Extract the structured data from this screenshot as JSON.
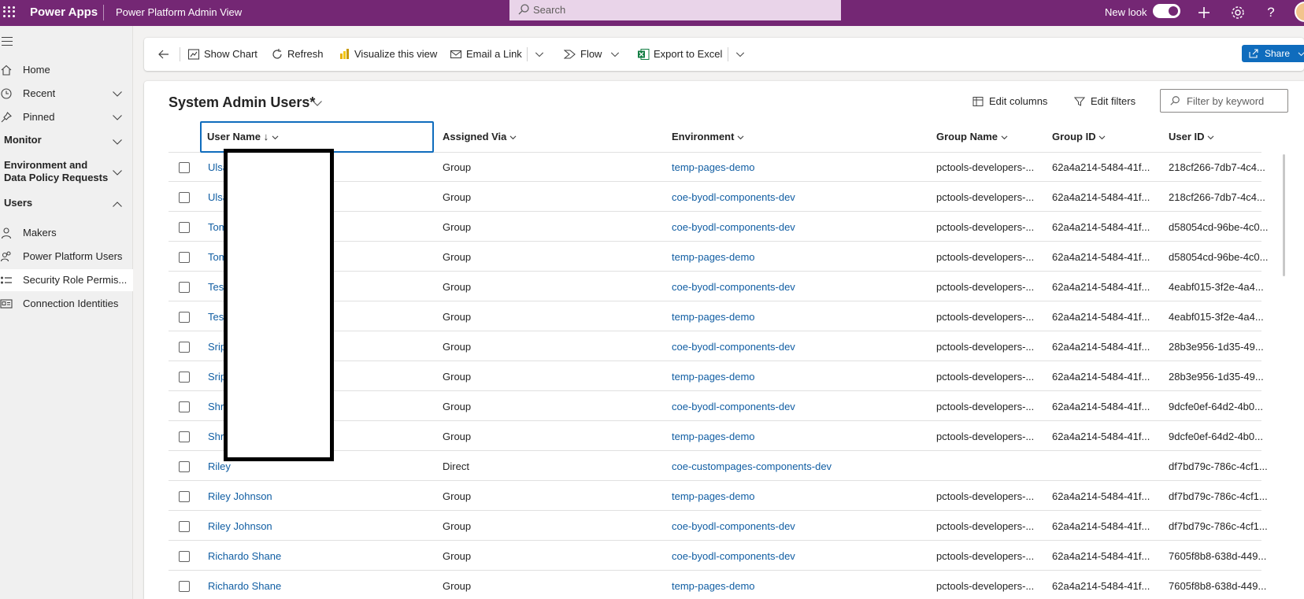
{
  "topbar": {
    "app_name": "Power Apps",
    "view_name": "Power Platform Admin View",
    "search_placeholder": "Search",
    "new_look_label": "New look",
    "new_look_on": true,
    "icons": [
      "waffle-icon",
      "search-icon",
      "plus-icon",
      "gear-icon",
      "help-icon",
      "avatar"
    ]
  },
  "nav": {
    "items": [
      {
        "label": "Home",
        "icon": "home-icon"
      },
      {
        "label": "Recent",
        "icon": "clock-icon",
        "expandable": true
      },
      {
        "label": "Pinned",
        "icon": "pin-icon",
        "expandable": true
      }
    ],
    "sections": [
      {
        "label": "Monitor"
      },
      {
        "label": "Environment and",
        "label2": "Data Policy Requests"
      },
      {
        "label": "Users"
      }
    ],
    "user_items": [
      {
        "label": "Makers",
        "icon": "person-icon"
      },
      {
        "label": "Power Platform Users",
        "icon": "people-icon"
      },
      {
        "label": "Security Role Permis...",
        "icon": "list-icon"
      },
      {
        "label": "Connection Identities",
        "icon": "id-card-icon"
      }
    ]
  },
  "commands": {
    "show_chart": "Show Chart",
    "refresh": "Refresh",
    "visualize": "Visualize this view",
    "email_link": "Email a Link",
    "flow": "Flow",
    "export_excel": "Export to Excel",
    "share": "Share"
  },
  "view": {
    "title": "System Admin Users*",
    "edit_columns": "Edit columns",
    "edit_filters": "Edit filters",
    "filter_placeholder": "Filter by keyword"
  },
  "grid": {
    "columns": [
      "User Name",
      "Assigned Via",
      "Environment",
      "Group Name",
      "Group ID",
      "User ID"
    ],
    "sort_indicator": "↓",
    "rows": [
      {
        "user": "Ulsa",
        "via": "Group",
        "env": "temp-pages-demo",
        "group": "pctools-developers-...",
        "gid": "62a4a214-5484-41f...",
        "uid": "218cf266-7db7-4c4..."
      },
      {
        "user": "Ulsa",
        "via": "Group",
        "env": "coe-byodl-components-dev",
        "group": "pctools-developers-...",
        "gid": "62a4a214-5484-41f...",
        "uid": "218cf266-7db7-4c4..."
      },
      {
        "user": "Tom",
        "via": "Group",
        "env": "coe-byodl-components-dev",
        "group": "pctools-developers-...",
        "gid": "62a4a214-5484-41f...",
        "uid": "d58054cd-96be-4c0..."
      },
      {
        "user": "Tom",
        "via": "Group",
        "env": "temp-pages-demo",
        "group": "pctools-developers-...",
        "gid": "62a4a214-5484-41f...",
        "uid": "d58054cd-96be-4c0..."
      },
      {
        "user": "Test",
        "via": "Group",
        "env": "coe-byodl-components-dev",
        "group": "pctools-developers-...",
        "gid": "62a4a214-5484-41f...",
        "uid": "4eabf015-3f2e-4a4..."
      },
      {
        "user": "Test",
        "via": "Group",
        "env": "temp-pages-demo",
        "group": "pctools-developers-...",
        "gid": "62a4a214-5484-41f...",
        "uid": "4eabf015-3f2e-4a4..."
      },
      {
        "user": "Srip",
        "via": "Group",
        "env": "coe-byodl-components-dev",
        "group": "pctools-developers-...",
        "gid": "62a4a214-5484-41f...",
        "uid": "28b3e956-1d35-49..."
      },
      {
        "user": "Srip",
        "via": "Group",
        "env": "temp-pages-demo",
        "group": "pctools-developers-...",
        "gid": "62a4a214-5484-41f...",
        "uid": "28b3e956-1d35-49..."
      },
      {
        "user": "Shr",
        "via": "Group",
        "env": "coe-byodl-components-dev",
        "group": "pctools-developers-...",
        "gid": "62a4a214-5484-41f...",
        "uid": "9dcfe0ef-64d2-4b0..."
      },
      {
        "user": "Shr",
        "via": "Group",
        "env": "temp-pages-demo",
        "group": "pctools-developers-...",
        "gid": "62a4a214-5484-41f...",
        "uid": "9dcfe0ef-64d2-4b0..."
      },
      {
        "user": "Riley",
        "via": "Direct",
        "env": "coe-custompages-components-dev",
        "group": "",
        "gid": "",
        "uid": "df7bd79c-786c-4cf1..."
      },
      {
        "user": "Riley Johnson",
        "via": "Group",
        "env": "temp-pages-demo",
        "group": "pctools-developers-...",
        "gid": "62a4a214-5484-41f...",
        "uid": "df7bd79c-786c-4cf1..."
      },
      {
        "user": "Riley Johnson",
        "via": "Group",
        "env": "coe-byodl-components-dev",
        "group": "pctools-developers-...",
        "gid": "62a4a214-5484-41f...",
        "uid": "df7bd79c-786c-4cf1..."
      },
      {
        "user": "Richardo Shane",
        "via": "Group",
        "env": "coe-byodl-components-dev",
        "group": "pctools-developers-...",
        "gid": "62a4a214-5484-41f...",
        "uid": "7605f8b8-638d-449..."
      },
      {
        "user": "Richardo Shane",
        "via": "Group",
        "env": "temp-pages-demo",
        "group": "pctools-developers-...",
        "gid": "62a4a214-5484-41f...",
        "uid": "7605f8b8-638d-449..."
      }
    ]
  },
  "colors": {
    "brand": "#742774",
    "link": "#115ea3",
    "primary_button": "#0f6cbd"
  }
}
